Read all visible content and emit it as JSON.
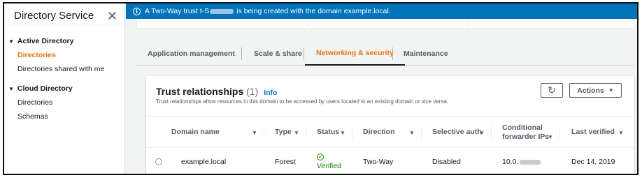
{
  "sidebar": {
    "title": "Directory Service",
    "close_glyph": "✕",
    "sections": [
      {
        "label": "Active Directory",
        "items": [
          "Directories",
          "Directories shared with me"
        ]
      },
      {
        "label": "Cloud Directory",
        "items": [
          "Directories",
          "Schemas"
        ]
      }
    ],
    "active_item": "Directories"
  },
  "banner": {
    "icon": "info-icon",
    "text_before": "A Two-Way trust t-S",
    "text_after": " is being created with the domain example.local."
  },
  "tabs": [
    {
      "label": "Application management"
    },
    {
      "label": "Scale & share"
    },
    {
      "label": "Networking & security",
      "active": true
    },
    {
      "label": "Maintenance"
    }
  ],
  "trust": {
    "title": "Trust relationships",
    "count": "(1)",
    "info": "Info",
    "description": "Trust relationships allow resources in this domain to be accessed by users located in an existing domain or vice versa.",
    "refresh_icon": "refresh-icon",
    "actions_label": "Actions",
    "columns": [
      {
        "label": "Domain name"
      },
      {
        "label": "Type"
      },
      {
        "label": "Status"
      },
      {
        "label": "Direction"
      },
      {
        "label": "Selective auth"
      },
      {
        "label_line1": "Conditional",
        "label_line2": "forwarder IPs"
      },
      {
        "label": "Last verified"
      }
    ],
    "rows": [
      {
        "domain": "example.local",
        "type": "Forest",
        "status": "Verified",
        "direction": "Two-Way",
        "selective_auth": "Disabled",
        "forwarder_ip_prefix": "10.0.",
        "last_verified": "Dec 14, 2019"
      }
    ]
  },
  "colors": {
    "accent": "#ec7211",
    "banner": "#0073bb",
    "success": "#1d8102",
    "link": "#0073bb"
  }
}
